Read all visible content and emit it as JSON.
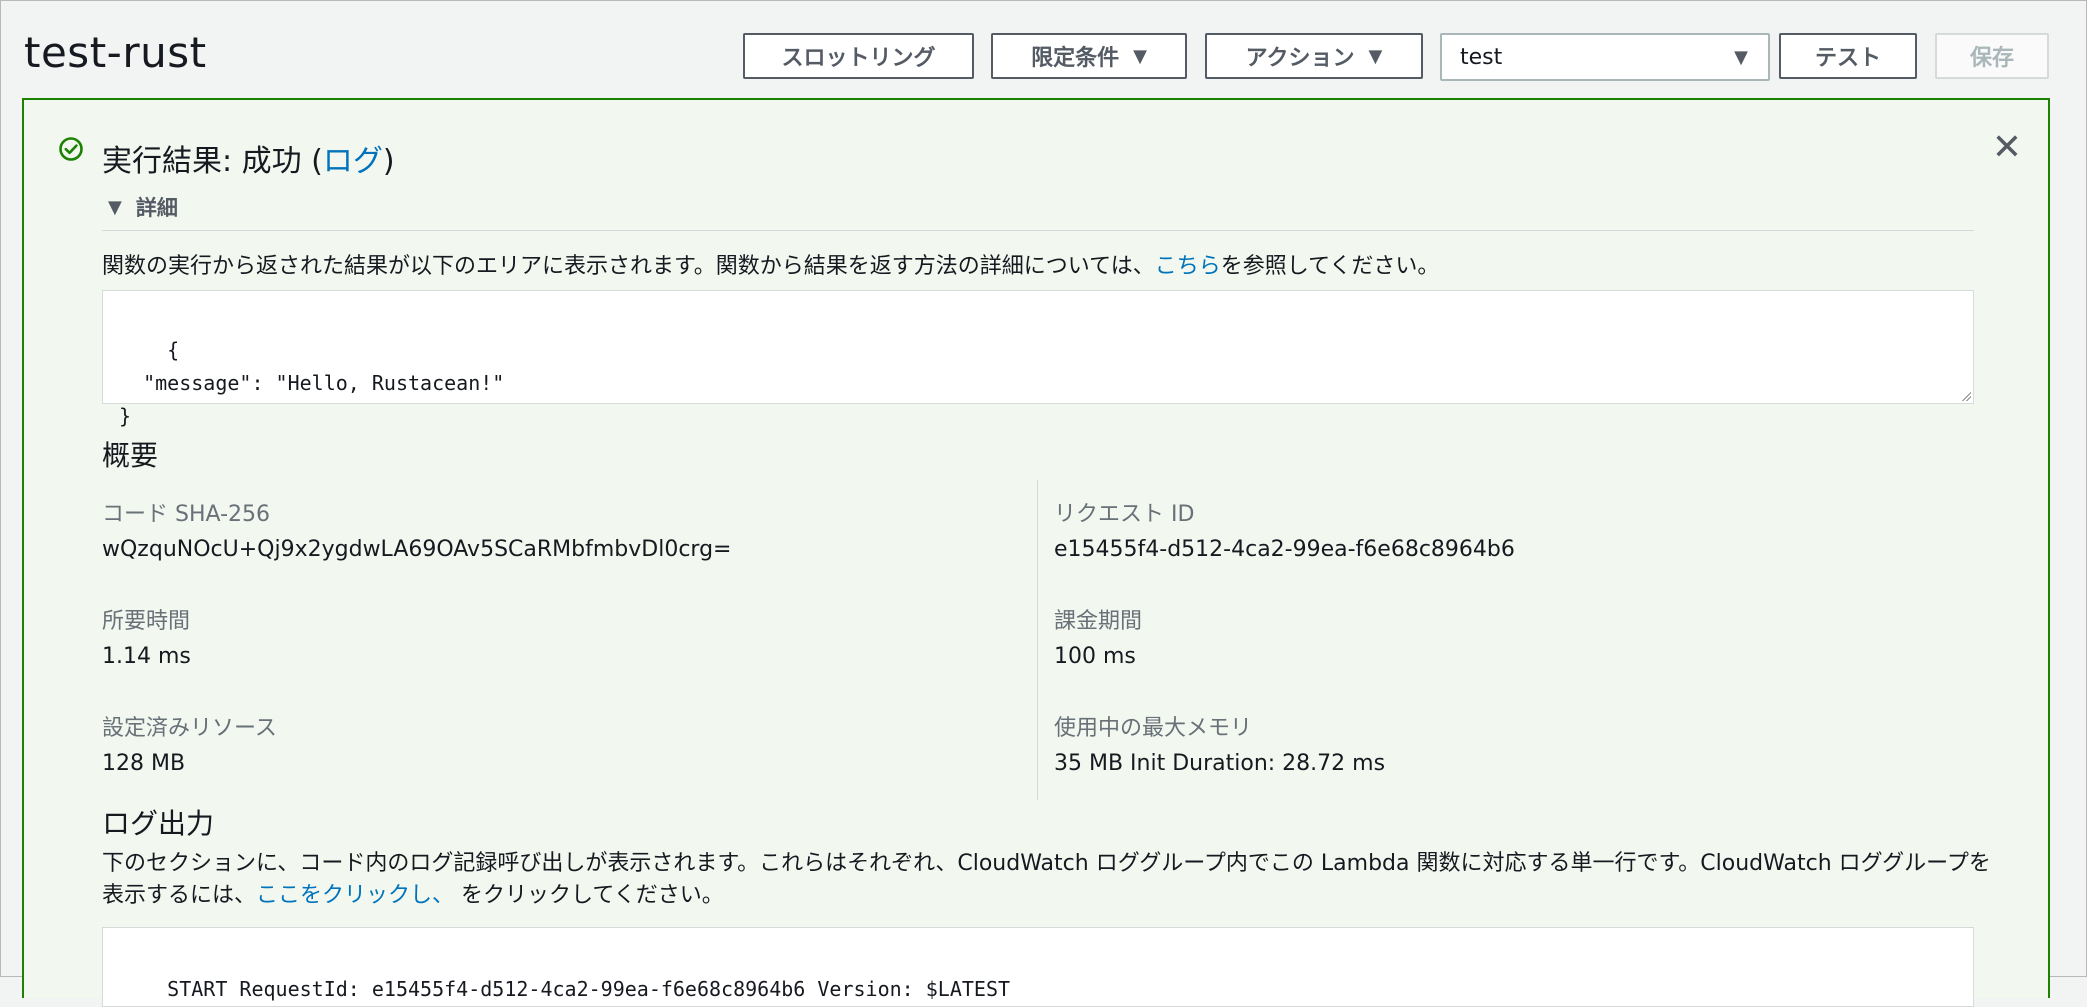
{
  "header": {
    "title": "test-rust",
    "throttle_label": "スロットリング",
    "qualifiers_label": "限定条件",
    "actions_label": "アクション",
    "test_event_value": "test",
    "test_label": "テスト",
    "save_label": "保存"
  },
  "result": {
    "status_prefix": "実行結果: 成功 (",
    "log_link": "ログ",
    "status_suffix": ")",
    "details_label": "詳細",
    "description_prefix": "関数の実行から返された結果が以下のエリアに表示されます。関数から結果を返す方法の詳細については、",
    "description_link": "こちら",
    "description_suffix": "を参照してください。",
    "output": "{\n  \"message\": \"Hello, Rustacean!\"\n}"
  },
  "summary": {
    "heading": "概要",
    "code_sha_label": "コード SHA-256",
    "code_sha_value": "wQzquNOcU+Qj9x2ygdwLA69OAv5SCaRMbfmbvDl0crg=",
    "request_id_label": "リクエスト ID",
    "request_id_value": "e15455f4-d512-4ca2-99ea-f6e68c8964b6",
    "duration_label": "所要時間",
    "duration_value": "1.14 ms",
    "billed_label": "課金期間",
    "billed_value": "100 ms",
    "resources_label": "設定済みリソース",
    "resources_value": "128 MB",
    "max_memory_label": "使用中の最大メモリ",
    "max_memory_value": "35 MB Init Duration: 28.72 ms"
  },
  "log_output": {
    "heading": "ログ出力",
    "description_prefix": "下のセクションに、コード内のログ記録呼び出しが表示されます。これらはそれぞれ、CloudWatch ロググループ内でこの Lambda 関数に対応する単一行です。CloudWatch ロググループを表示するには、",
    "description_link": "ここをクリックし、",
    "description_suffix": " をクリックしてください。",
    "lines": "START RequestId: e15455f4-d512-4ca2-99ea-f6e68c8964b6 Version: $LATEST"
  },
  "colors": {
    "success_border": "#1d8102",
    "success_bg": "#f2f8f0",
    "link": "#0073bb"
  },
  "icons": {
    "status": "check-circle-icon",
    "close": "close-icon",
    "dropdown": "caret-down-icon",
    "expand": "caret-down-icon"
  }
}
